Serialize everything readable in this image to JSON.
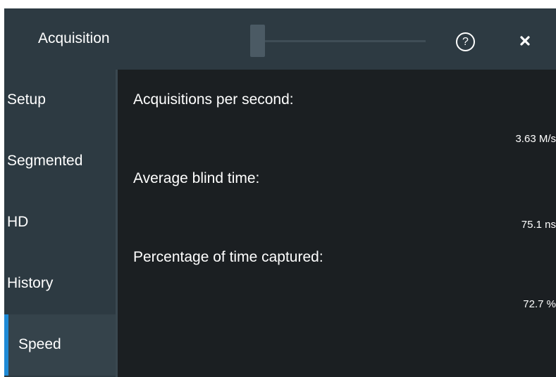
{
  "window": {
    "title": "Acquisition",
    "help_label": "?",
    "help_icon": "question-circle-icon",
    "close_icon": "close-icon"
  },
  "sidebar": {
    "items": [
      {
        "label": "Setup",
        "active": false
      },
      {
        "label": "Segmented",
        "active": false
      },
      {
        "label": "HD",
        "active": false
      },
      {
        "label": "History",
        "active": false
      },
      {
        "label": "Speed",
        "active": true
      }
    ]
  },
  "speed": {
    "fields": [
      {
        "label": "Acquisitions per second:",
        "value": "3.63 M/s"
      },
      {
        "label": "Average blind time:",
        "value": "75.1 ns"
      },
      {
        "label": "Percentage of time captured:",
        "value": "72.7 %"
      }
    ]
  },
  "colors": {
    "titlebar": "#2d3a42",
    "content_bg": "#1b1f22",
    "accent": "#1e8ad6",
    "text": "#ffffff"
  }
}
